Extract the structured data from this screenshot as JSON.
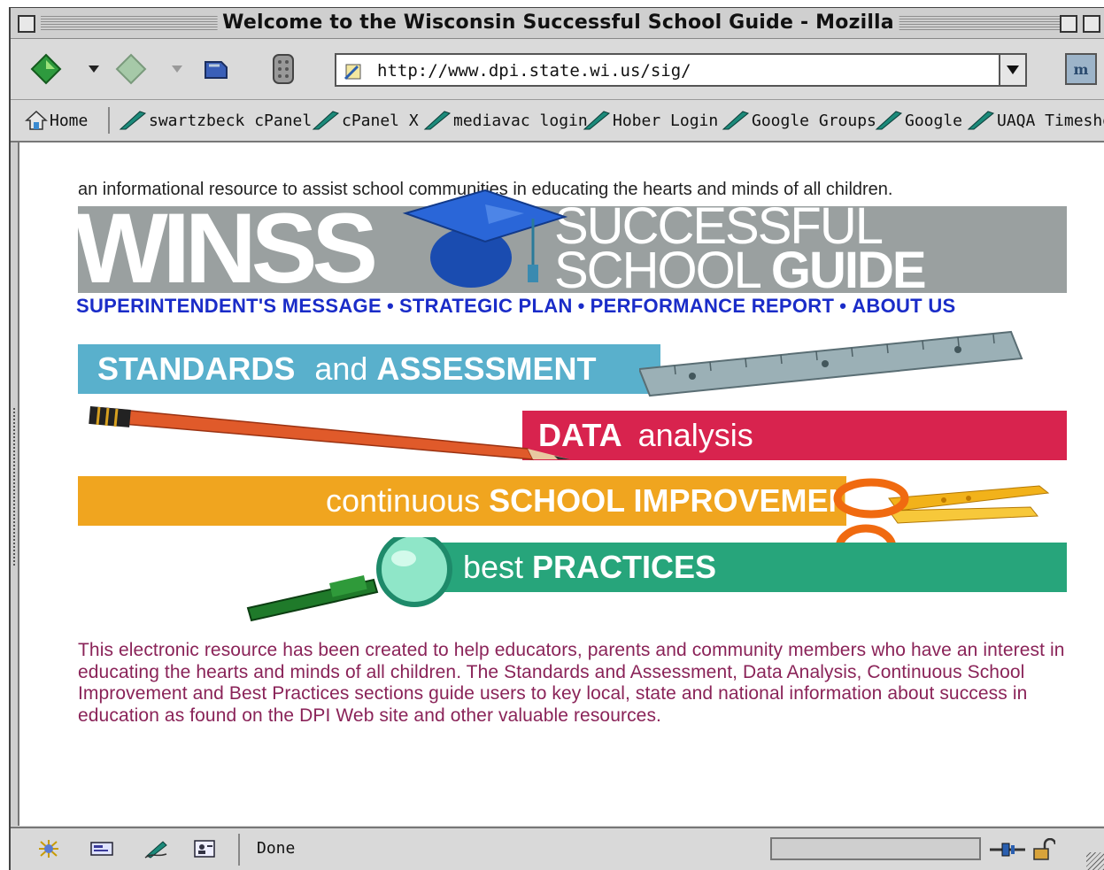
{
  "window": {
    "title": "Welcome to the Wisconsin Successful School Guide - Mozilla"
  },
  "toolbar": {
    "url": "http://www.dpi.state.wi.us/sig/",
    "icons": [
      "back-arrow-icon",
      "forward-arrow-icon",
      "reload-icon",
      "stop-icon",
      "page-proxy-icon",
      "mozilla-logo-icon"
    ]
  },
  "bookmarks": [
    "Home",
    "swartzbeck cPanel",
    "cPanel X",
    "mediavac login",
    "Hober Login",
    "Google Groups",
    "Google",
    "UAQA Timesheet"
  ],
  "page": {
    "tagline": "an informational resource to assist school communities in educating the hearts and minds of all children.",
    "logo": {
      "word": "WINSS",
      "line1": "SUCCESSFUL",
      "line2a": "SCHOOL",
      "line2b": "GUIDE"
    },
    "menu": [
      "SUPERINTENDENT'S MESSAGE",
      "STRATEGIC PLAN",
      "PERFORMANCE REPORT",
      "ABOUT US"
    ],
    "menu_separator": "•",
    "sections": {
      "standards": {
        "a": "STANDARDS",
        "b": "and",
        "c": "ASSESSMENT"
      },
      "data": {
        "a": "DATA",
        "b": "analysis"
      },
      "continuous": {
        "a": "continuous",
        "b": "SCHOOL IMPROVEMENT"
      },
      "best": {
        "a": "best",
        "b": "PRACTICES"
      }
    },
    "description": "This electronic resource has been created to help educators, parents and community members who have an interest in educating the hearts and minds of all children. The Standards and Assessment, Data Analysis, Continuous School Improvement and Best Practices sections guide users to key local, state and national information about success in education as found on the DPI Web site and other valuable resources."
  },
  "status": {
    "text": "Done"
  },
  "colors": {
    "standards": "#59b0cc",
    "data": "#d8234e",
    "continuous": "#f0a51f",
    "best": "#27a57b",
    "menu_link": "#1a2cc8",
    "description": "#8a2358",
    "banner": "#9aa0a0"
  }
}
